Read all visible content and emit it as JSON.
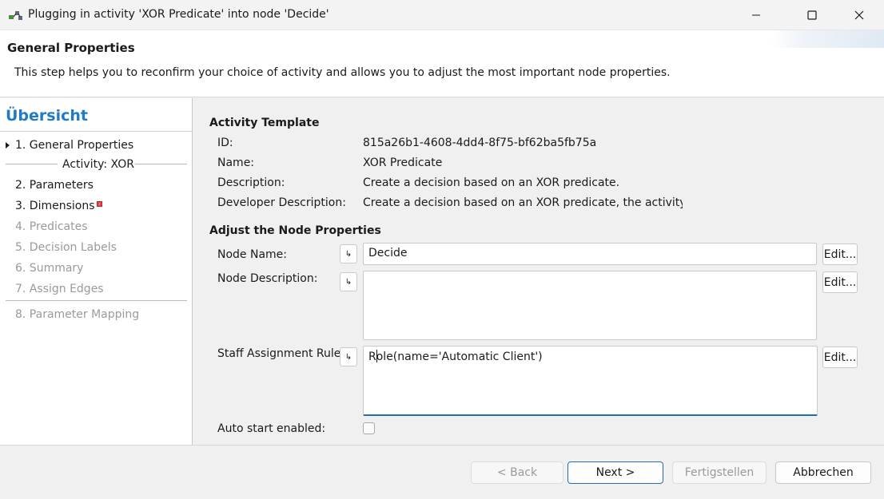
{
  "window": {
    "title": "Plugging in activity 'XOR Predicate' into node 'Decide'",
    "icons": {
      "app": "plugin-icon",
      "minimize": "minimize-icon",
      "maximize": "maximize-icon",
      "close": "close-icon"
    }
  },
  "header": {
    "title": "General Properties",
    "description": "This step helps you to reconfirm your choice of activity and allows you to adjust the most important node properties."
  },
  "sidebar": {
    "title": "Übersicht",
    "steps": [
      {
        "label": "1. General Properties",
        "state": "current"
      },
      {
        "label": "Activity: XOR",
        "state": "group"
      },
      {
        "label": "2. Parameters",
        "state": "enabled"
      },
      {
        "label": "3. Dimensions",
        "state": "error"
      },
      {
        "label": "4. Predicates",
        "state": "disabled"
      },
      {
        "label": "5. Decision Labels",
        "state": "disabled"
      },
      {
        "label": "6. Summary",
        "state": "disabled"
      },
      {
        "label": "7. Assign Edges",
        "state": "disabled"
      },
      {
        "label": "8. Parameter Mapping",
        "state": "disabled"
      }
    ]
  },
  "activity_template": {
    "section_title": "Activity Template",
    "id_label": "ID:",
    "id_value": "815a26b1-4608-4dd4-8f75-bf62ba5fb75a",
    "name_label": "Name:",
    "name_value": "XOR Predicate",
    "description_label": "Description:",
    "description_value": "Create a decision based on an XOR predicate.",
    "dev_description_label": "Developer Description:",
    "dev_description_value": "Create a decision based on an XOR predicate, the activity ne"
  },
  "node_properties": {
    "section_title": "Adjust the Node Properties",
    "node_name_label": "Node Name:",
    "node_name_value": "Decide",
    "node_description_label": "Node Description:",
    "node_description_value": "",
    "staff_rule_label": "Staff Assignment Rule:",
    "staff_rule_value_first": "R",
    "staff_rule_value_rest": "ole(name='Automatic Client')",
    "auto_start_label": "Auto start enabled:",
    "auto_start_checked": false,
    "arrow_glyph": "↳",
    "edit_label": "Edit..."
  },
  "footer": {
    "back_label": "< Back",
    "next_label": "Next >",
    "finish_label": "Fertigstellen",
    "cancel_label": "Abbrechen"
  }
}
